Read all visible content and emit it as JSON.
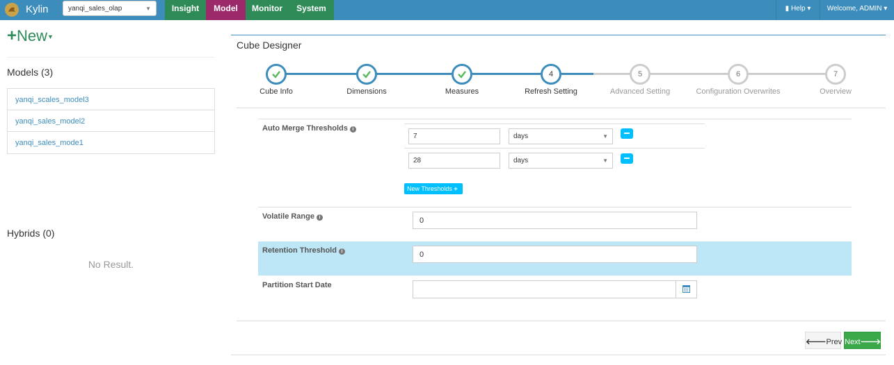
{
  "app": {
    "brand": "Kylin",
    "project_selected": "yanqi_sales_olap"
  },
  "nav": {
    "tabs": [
      {
        "label": "Insight",
        "color": "#2e8b57"
      },
      {
        "label": "Model",
        "color": "#9c2a6a"
      },
      {
        "label": "Monitor",
        "color": "#2e8b57"
      },
      {
        "label": "System",
        "color": "#2e8b57"
      }
    ],
    "help_label": "Help",
    "welcome_label": "Welcome, ADMIN"
  },
  "sidebar": {
    "new_label": "New",
    "models_title": "Models (3)",
    "models": [
      "yanqi_scales_model3",
      "yanqi_sales_model2",
      "yanqi_sales_mode1"
    ],
    "hybrids_title": "Hybrids (0)",
    "hybrids_empty": "No Result."
  },
  "designer": {
    "title": "Cube Designer",
    "steps": [
      {
        "num": "1",
        "label": "Cube Info",
        "state": "done"
      },
      {
        "num": "2",
        "label": "Dimensions",
        "state": "done"
      },
      {
        "num": "3",
        "label": "Measures",
        "state": "done"
      },
      {
        "num": "4",
        "label": "Refresh Setting",
        "state": "current"
      },
      {
        "num": "5",
        "label": "Advanced Setting",
        "state": "todo"
      },
      {
        "num": "6",
        "label": "Configuration Overwrites",
        "state": "todo"
      },
      {
        "num": "7",
        "label": "Overview",
        "state": "todo"
      }
    ]
  },
  "form": {
    "auto_merge_label": "Auto Merge Thresholds",
    "thresholds": [
      {
        "value": "7",
        "unit": "days"
      },
      {
        "value": "28",
        "unit": "days"
      }
    ],
    "new_thresholds_label": "New Thresholds",
    "volatile_label": "Volatile Range",
    "volatile_value": "0",
    "retention_label": "Retention Threshold",
    "retention_value": "0",
    "partition_label": "Partition Start Date",
    "partition_value": ""
  },
  "footer": {
    "prev_label": "Prev",
    "next_label": "Next"
  },
  "colors": {
    "topbar": "#3c8dbc",
    "accent": "#00bfff",
    "highlight": "#bde6f7",
    "next": "#3ba84a"
  }
}
